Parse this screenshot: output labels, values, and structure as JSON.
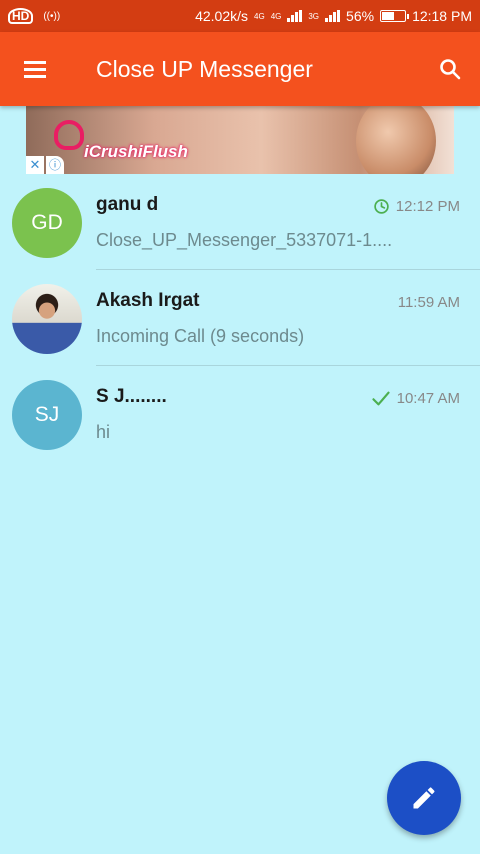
{
  "status_bar": {
    "hd": "HD",
    "net_speed": "42.02k/s",
    "net_type_1": "4G",
    "net_type_2": "4G",
    "net_type_3": "3G",
    "battery_percent": "56%",
    "battery_level": 0.56,
    "time": "12:18 PM"
  },
  "app_bar": {
    "title": "Close UP Messenger",
    "menu_icon": "hamburger-menu-icon",
    "search_icon": "search-icon"
  },
  "ad": {
    "brand": "iCrushiFlush",
    "close_glyph": "✕",
    "info_glyph": "ⓘ"
  },
  "conversations": [
    {
      "initials": "GD",
      "avatar_color": "#7bc24e",
      "name": "ganu d",
      "time": "12:12 PM",
      "status_icon": "clock-icon",
      "status_color": "#4caf50",
      "preview": "Close_UP_Messenger_5337071-1...."
    },
    {
      "initials": "",
      "avatar_color": "",
      "name": "Akash Irgat",
      "time": "11:59 AM",
      "status_icon": "",
      "preview": "Incoming Call (9 seconds)"
    },
    {
      "initials": "SJ",
      "avatar_color": "#5bb5d0",
      "name": "S J........",
      "time": "10:47 AM",
      "status_icon": "check-icon",
      "status_color": "#4caf50",
      "preview": "hi"
    }
  ],
  "fab": {
    "icon": "pencil-icon",
    "color": "#1c4fc6"
  },
  "colors": {
    "status_bar": "#d33d12",
    "app_bar": "#f4511e",
    "background": "#c0f3fb"
  }
}
